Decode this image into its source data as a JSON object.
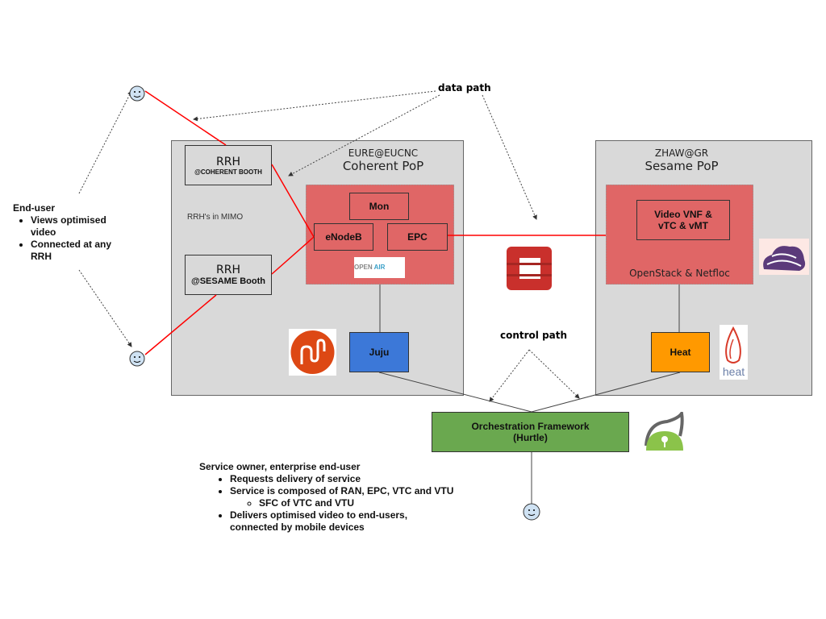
{
  "coherent_pop": {
    "site": "EURE@EUCNC",
    "name": "Coherent PoP",
    "rrh_note": "RRH's in MIMO",
    "rrh1": {
      "title": "RRH",
      "location": "@COHERENT BOOTH"
    },
    "rrh2": {
      "title": "RRH",
      "location": "@SESAME Booth"
    },
    "mon": "Mon",
    "enodeb": "eNodeB",
    "epc": "EPC",
    "oai_logo": "OPEN AIR INTERFACE 5G",
    "juju": "Juju"
  },
  "sesame_pop": {
    "site": "ZHAW@GR",
    "name": "Sesame PoP",
    "vnf": "Video VNF & vTC & vMT",
    "platform": "OpenStack & Netfloc",
    "heat": "Heat",
    "heat_logo": "heat"
  },
  "labels": {
    "data_path": "data path",
    "control_path": "control path"
  },
  "orchestration": {
    "line1": "Orchestration Framework",
    "line2": "(Hurtle)"
  },
  "end_user": {
    "title": "End-user",
    "bullets": [
      "Views optimised video",
      "Connected at any RRH"
    ]
  },
  "service_owner": {
    "title": "Service owner, enterprise end-user",
    "bullets": [
      "Requests delivery of service",
      "Service is composed of RAN, EPC, VTC and VTU"
    ],
    "sub_bullet": "SFC of VTC and VTU",
    "last_bullet": "Delivers optimised video to end-users, connected by mobile devices"
  },
  "colors": {
    "pop_bg": "#d9d9d9",
    "nfv_region": "#e06666",
    "juju": "#3c78d8",
    "heat": "#ff9900",
    "orchestration": "#6aa84f",
    "data_link": "#ff0000"
  }
}
